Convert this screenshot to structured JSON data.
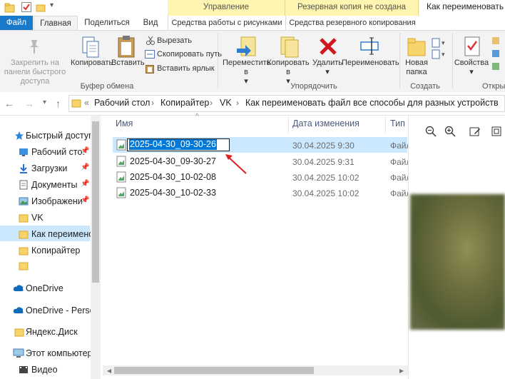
{
  "window": {
    "title": "Как переименовать"
  },
  "context_headers": {
    "manage": "Управление",
    "backup": "Резервная копия не создана"
  },
  "ribbon_tabs": [
    "Файл",
    "Главная",
    "Поделиться",
    "Вид"
  ],
  "context_tabs": {
    "picture_tools": "Средства работы с рисунками",
    "backup_tools": "Средства резервного копирования"
  },
  "clipboard": {
    "pin": "Закрепить на панели быстрого доступа",
    "copy": "Копировать",
    "paste": "Вставить",
    "cut": "Вырезать",
    "copy_path": "Скопировать путь",
    "paste_shortcut": "Вставить ярлык",
    "group": "Буфер обмена"
  },
  "organize": {
    "move_to": "Переместить в",
    "copy_to": "Копировать в",
    "delete": "Удалить",
    "rename": "Переименовать",
    "group": "Упорядочить"
  },
  "create": {
    "new_folder": "Новая папка",
    "group": "Создать"
  },
  "open": {
    "properties": "Свойства",
    "group": "Откры"
  },
  "breadcrumb": [
    "Рабочий стол",
    "Копирайтер",
    "VK",
    "Как переименовать файл все способы для разных устройств"
  ],
  "breadcrumb_prefix": "«",
  "nav": {
    "quick_access": "Быстрый доступ",
    "desktop": "Рабочий сто.",
    "downloads": "Загрузки",
    "documents": "Документы",
    "images": "Изображени",
    "vk": "VK",
    "current": "Как переимено",
    "copywriter": "Копирайтер",
    "onedrive": "OneDrive",
    "onedrive_personal": "OneDrive - Person",
    "yandex": "Яндекс.Диск",
    "this_pc": "Этот компьютер",
    "video": "Видео"
  },
  "columns": {
    "name": "Имя",
    "date": "Дата изменения",
    "type": "Тип"
  },
  "files": [
    {
      "name": "2025-04-30_09-30-26",
      "date": "30.04.2025 9:30",
      "type": "Файл"
    },
    {
      "name": "2025-04-30_09-30-27",
      "date": "30.04.2025 9:31",
      "type": "Файл"
    },
    {
      "name": "2025-04-30_10-02-08",
      "date": "30.04.2025 10:02",
      "type": "Файл"
    },
    {
      "name": "2025-04-30_10-02-33",
      "date": "30.04.2025 10:02",
      "type": "Файл"
    }
  ],
  "rename_value": "2025-04-30_09-30-26",
  "colors": {
    "accent": "#1979ca",
    "selection": "#cce8ff",
    "arrow": "#e02020",
    "delete_icon": "#d0161f"
  },
  "icons": [
    "check-icon",
    "folder-icon",
    "pin-icon",
    "copy-icon",
    "paste-icon",
    "scissors-icon",
    "delete-icon",
    "rename-icon",
    "properties-icon",
    "zoom-in-icon",
    "zoom-out-icon"
  ]
}
